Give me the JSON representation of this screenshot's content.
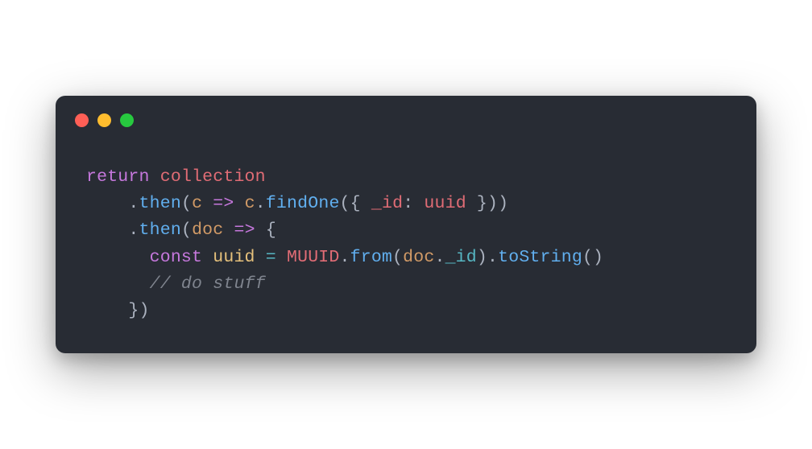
{
  "window": {
    "traffic_lights": {
      "close": "close",
      "minimize": "minimize",
      "zoom": "zoom"
    }
  },
  "code": {
    "line1": {
      "return": "return",
      "collection": "collection"
    },
    "line2": {
      "indent": "    ",
      "dot": ".",
      "then": "then",
      "open_paren": "(",
      "param_c": "c",
      "arrow": "=>",
      "c2": "c",
      "dot2": ".",
      "findOne": "findOne",
      "open_paren2": "(",
      "open_brace": "{ ",
      "id_key": "_id",
      "colon": ": ",
      "uuid": "uuid",
      "close_brace": " }",
      "close_paren2": ")",
      "close_paren": ")"
    },
    "line3": {
      "indent": "    ",
      "dot": ".",
      "then": "then",
      "open_paren": "(",
      "param_doc": "doc",
      "arrow": "=>",
      "open_brace": "{"
    },
    "line4": {
      "indent": "      ",
      "const": "const",
      "uuid_var": "uuid",
      "eq": "=",
      "muuid": "MUUID",
      "dot": ".",
      "from": "from",
      "open_paren": "(",
      "doc": "doc",
      "dot2": ".",
      "id_prop": "_id",
      "close_paren": ")",
      "dot3": ".",
      "toString": "toString",
      "open_paren2": "(",
      "close_paren2": ")"
    },
    "line5": {
      "indent": "      ",
      "comment": "// do stuff"
    },
    "line6": {
      "indent": "    ",
      "close_brace": "}",
      "close_paren": ")"
    }
  }
}
